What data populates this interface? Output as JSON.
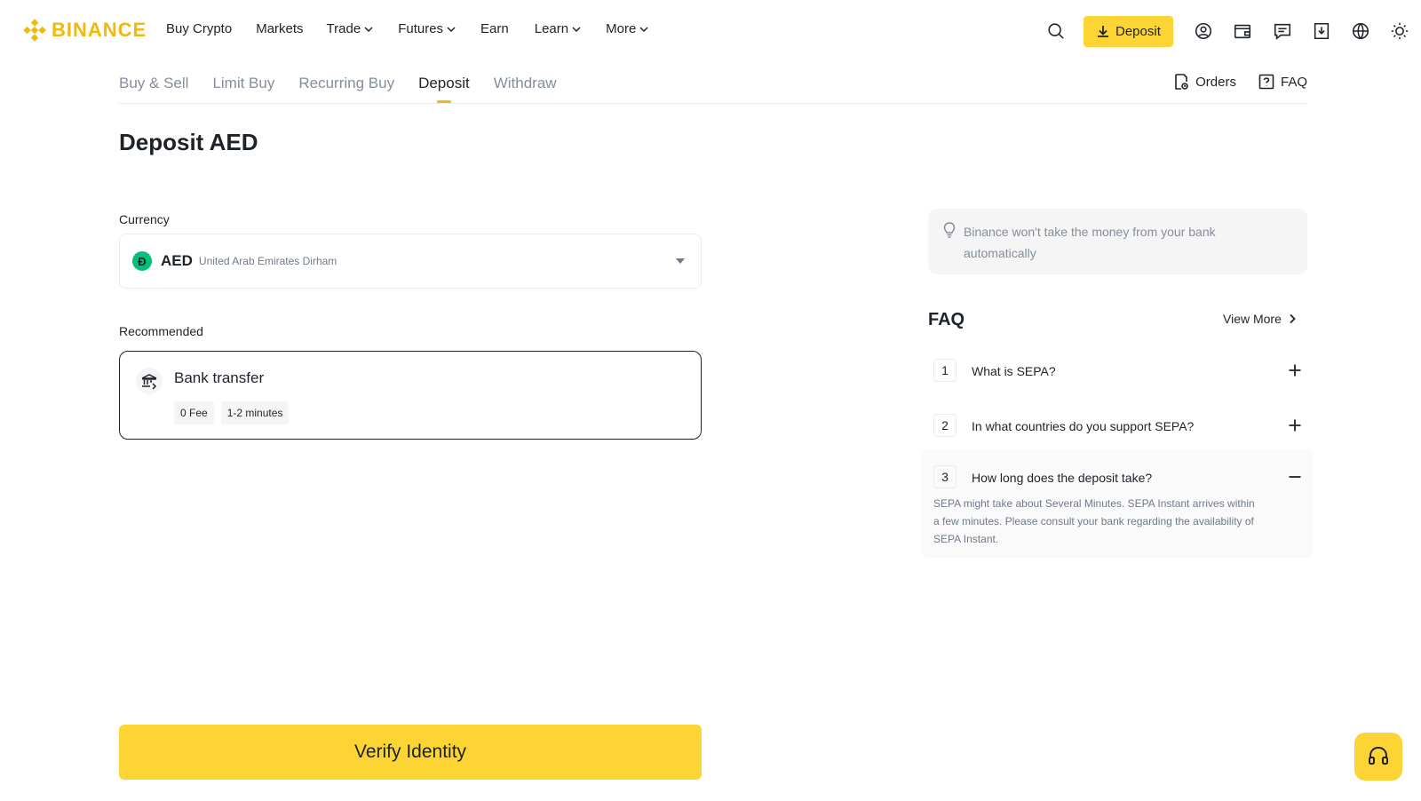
{
  "brand": {
    "name": "BINANCE",
    "accent": "#F0B90B",
    "button_yellow": "#FCD535"
  },
  "nav": {
    "items": [
      {
        "label": "Buy Crypto",
        "has_dropdown": false
      },
      {
        "label": "Markets",
        "has_dropdown": false
      },
      {
        "label": "Trade",
        "has_dropdown": true
      },
      {
        "label": "Futures",
        "has_dropdown": true
      },
      {
        "label": "Earn",
        "has_dropdown": false
      },
      {
        "label": "Learn",
        "has_dropdown": true
      },
      {
        "label": "More",
        "has_dropdown": true
      }
    ],
    "deposit_label": "Deposit",
    "icons": [
      "search-icon",
      "download-icon",
      "user-icon",
      "wallet-icon",
      "message-icon",
      "app-download-icon",
      "globe-icon",
      "sun-icon"
    ]
  },
  "subtabs": {
    "items": [
      "Buy & Sell",
      "Limit Buy",
      "Recurring Buy",
      "Deposit",
      "Withdraw"
    ],
    "active": "Deposit",
    "orders_label": "Orders",
    "faq_label": "FAQ"
  },
  "page": {
    "title": "Deposit AED"
  },
  "currency": {
    "label": "Currency",
    "symbol": "Đ",
    "code": "AED",
    "name": "United Arab Emirates Dirham"
  },
  "recommended": {
    "label": "Recommended",
    "method": {
      "title": "Bank transfer",
      "tags": [
        "0 Fee",
        "1-2 minutes"
      ]
    }
  },
  "notice": {
    "text": "Binance won't take the money from your bank automatically"
  },
  "faq": {
    "title": "FAQ",
    "view_more": "View More",
    "items": [
      {
        "num": "1",
        "question": "What is SEPA?",
        "expanded": false
      },
      {
        "num": "2",
        "question": "In what countries do you support SEPA?",
        "expanded": false
      },
      {
        "num": "3",
        "question": "How long does the deposit take?",
        "expanded": true,
        "answer": "SEPA might take about Several Minutes. SEPA Instant arrives within a few minutes. Please consult your bank regarding the availability of SEPA Instant."
      }
    ]
  },
  "cta": {
    "verify_label": "Verify Identity"
  }
}
